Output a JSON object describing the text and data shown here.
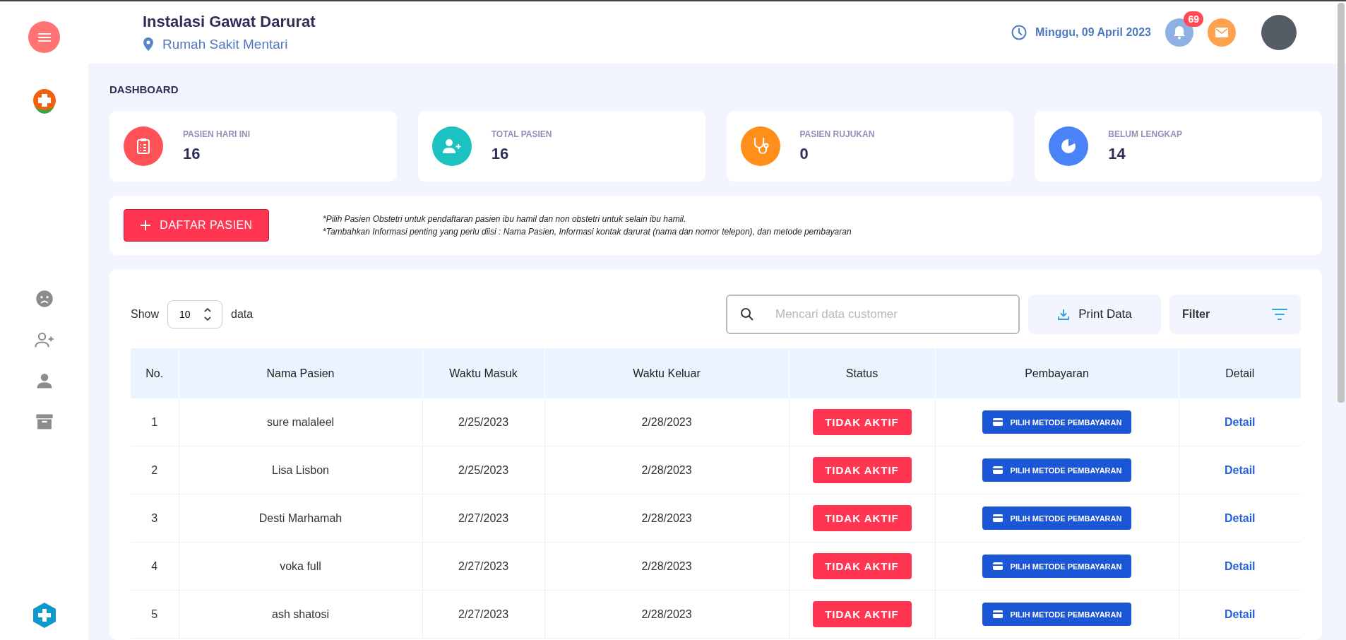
{
  "header": {
    "title": "Instalasi Gawat Darurat",
    "location": "Rumah Sakit Mentari",
    "date": "Minggu, 09 April 2023",
    "notification_count": "69"
  },
  "section_title": "DASHBOARD",
  "stats": [
    {
      "kind": "clipboard",
      "label": "PASIEN HARI INI",
      "value": "16",
      "color": "#ff5257"
    },
    {
      "kind": "user-plus",
      "label": "TOTAL PASIEN",
      "value": "16",
      "color": "#1cc1c1"
    },
    {
      "kind": "stethoscope",
      "label": "PASIEN RUJUKAN",
      "value": "0",
      "color": "#ff8f1a"
    },
    {
      "kind": "pie",
      "label": "BELUM LENGKAP",
      "value": "14",
      "color": "#4a82f7"
    }
  ],
  "register_button": "DAFTAR PASIEN",
  "notes": [
    "*Pilih Pasien Obstetri untuk pendaftaran pasien ibu hamil dan non obstetri untuk selain ibu hamil.",
    "*Tambahkan Informasi penting yang perlu diisi : Nama Pasien, Informasi kontak darurat (nama dan nomor telepon), dan metode pembayaran"
  ],
  "table_controls": {
    "show_label": "Show",
    "page_size": "10",
    "page_size_suffix": "data",
    "search_placeholder": "Mencari data customer",
    "print_button": "Print Data",
    "filter_button": "Filter"
  },
  "table": {
    "columns": [
      "No.",
      "Nama Pasien",
      "Waktu Masuk",
      "Waktu Keluar",
      "Status",
      "Pembayaran",
      "Detail"
    ],
    "rows": [
      {
        "no": "1",
        "name": "sure malaleel",
        "in": "2/25/2023",
        "out": "2/28/2023",
        "status": "TIDAK AKTIF",
        "payment": "PILIH METODE PEMBAYARAN",
        "detail": "Detail"
      },
      {
        "no": "2",
        "name": "Lisa Lisbon",
        "in": "2/25/2023",
        "out": "2/28/2023",
        "status": "TIDAK AKTIF",
        "payment": "PILIH METODE PEMBAYARAN",
        "detail": "Detail"
      },
      {
        "no": "3",
        "name": "Desti Marhamah",
        "in": "2/27/2023",
        "out": "2/28/2023",
        "status": "TIDAK AKTIF",
        "payment": "PILIH METODE PEMBAYARAN",
        "detail": "Detail"
      },
      {
        "no": "4",
        "name": "voka full",
        "in": "2/27/2023",
        "out": "2/28/2023",
        "status": "TIDAK AKTIF",
        "payment": "PILIH METODE PEMBAYARAN",
        "detail": "Detail"
      },
      {
        "no": "5",
        "name": "ash shatosi",
        "in": "2/27/2023",
        "out": "2/28/2023",
        "status": "TIDAK AKTIF",
        "payment": "PILIH METODE PEMBAYARAN",
        "detail": "Detail"
      }
    ]
  }
}
